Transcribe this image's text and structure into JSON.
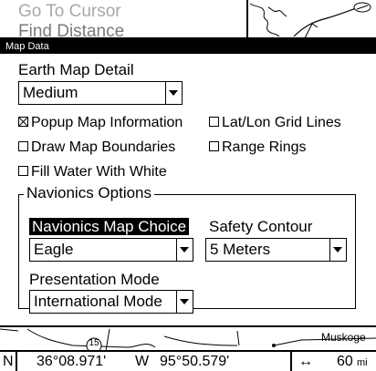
{
  "background_menu": {
    "items": [
      "Go To Cursor",
      "Find Distance"
    ]
  },
  "dialog": {
    "title": "Map Data",
    "earth_map_detail": {
      "label": "Earth Map Detail",
      "value": "Medium"
    },
    "checkboxes": {
      "popup_map_info": {
        "label": "Popup Map Information",
        "checked": true
      },
      "lat_lon_grid": {
        "label": "Lat/Lon Grid Lines",
        "checked": false
      },
      "draw_boundaries": {
        "label": "Draw Map Boundaries",
        "checked": false
      },
      "range_rings": {
        "label": "Range Rings",
        "checked": false
      },
      "fill_water": {
        "label": "Fill Water With White",
        "checked": false
      }
    },
    "navionics": {
      "group_label": "Navionics Options",
      "map_choice_label": "Navionics Map Choice",
      "map_choice_value": "Eagle",
      "safety_contour_label": "Safety Contour",
      "safety_contour_value": "5 Meters",
      "presentation_label": "Presentation Mode",
      "presentation_value": "International Mode"
    }
  },
  "map_strip": {
    "place_label": "Muskoge",
    "route_marker": "15"
  },
  "status_bar": {
    "lat_hemisphere": "N",
    "lat_value": "36°08.971'",
    "lon_hemisphere": "W",
    "lon_value": "95°50.579'",
    "range_icon": "↔",
    "range_value": "60",
    "range_unit": "mi"
  }
}
